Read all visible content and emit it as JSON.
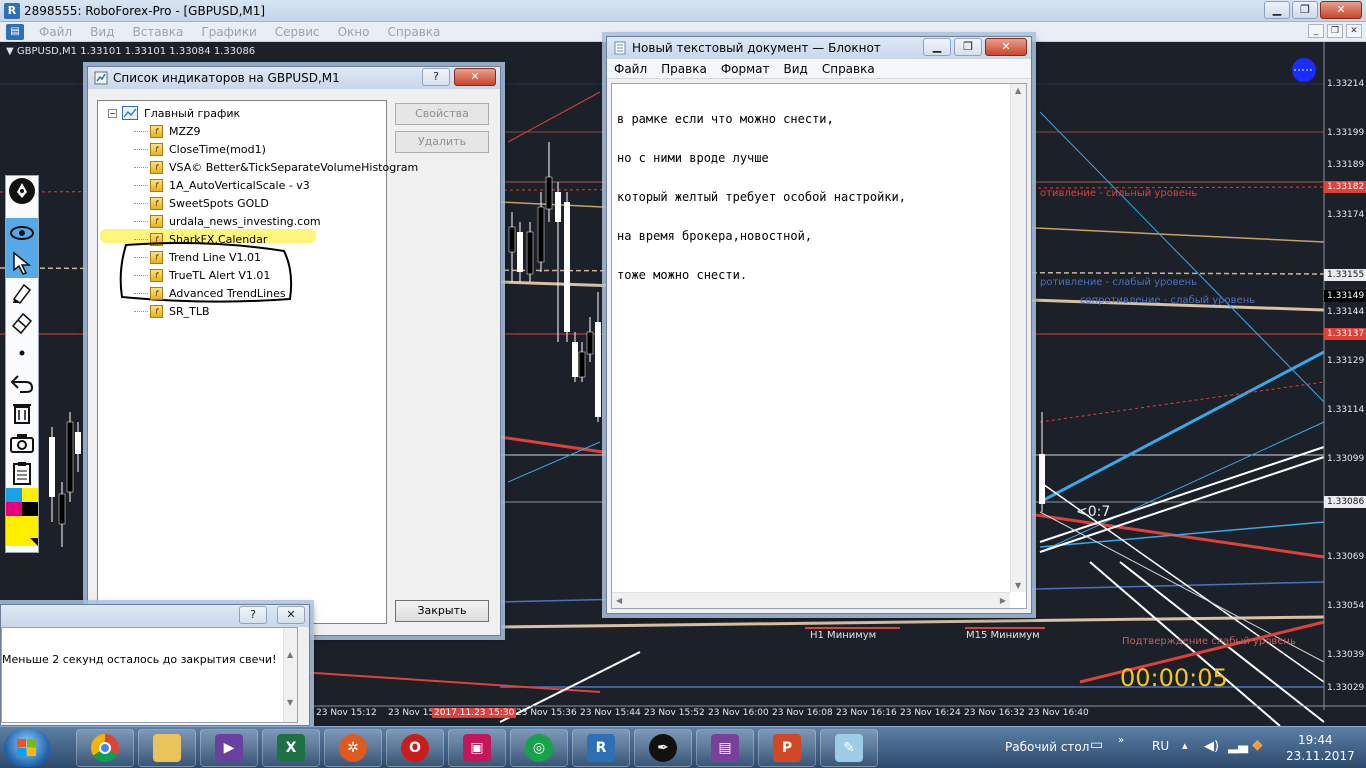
{
  "app": {
    "title": "2898555: RoboForex-Pro - [GBPUSD,M1]",
    "icon_letter": "R",
    "menu": [
      "Файл",
      "Вид",
      "Вставка",
      "Графики",
      "Сервис",
      "Окно",
      "Справка"
    ]
  },
  "chart": {
    "symbol_info": "▼ GBPUSD,M1  1.33101 1.33101 1.33084 1.33086",
    "price_labels": [
      {
        "text": "1.33214",
        "style": "plain"
      },
      {
        "text": "1.33199",
        "style": "plain"
      },
      {
        "text": "1.33189",
        "style": "plain"
      },
      {
        "text": "1.33182",
        "style": "red"
      },
      {
        "text": "1.33174",
        "style": "plain"
      },
      {
        "text": "1.33155",
        "style": "boxed"
      },
      {
        "text": "1.33149",
        "style": "dark"
      },
      {
        "text": "1.33144",
        "style": "plain"
      },
      {
        "text": "1.33137",
        "style": "red"
      },
      {
        "text": "1.33129",
        "style": "plain"
      },
      {
        "text": "1.33114",
        "style": "plain"
      },
      {
        "text": "1.33099",
        "style": "plain"
      },
      {
        "text": "1.33086",
        "style": "boxed"
      },
      {
        "text": "1.33069",
        "style": "plain"
      },
      {
        "text": "1.33054",
        "style": "plain"
      },
      {
        "text": "1.33039",
        "style": "plain"
      },
      {
        "text": "1.33029",
        "style": "plain"
      }
    ],
    "time_labels": [
      {
        "text": "23 Nov 15:12",
        "style": "plain"
      },
      {
        "text": "23 Nov 15:",
        "style": "plain"
      },
      {
        "text": "2017.11.23 15:30",
        "style": "red"
      },
      {
        "text": "23 Nov 15:36",
        "style": "plain"
      },
      {
        "text": "23 Nov 15:44",
        "style": "plain"
      },
      {
        "text": "23 Nov 15:52",
        "style": "plain"
      },
      {
        "text": "23 Nov 16:00",
        "style": "plain"
      },
      {
        "text": "23 Nov 16:08",
        "style": "plain"
      },
      {
        "text": "23 Nov 16:16",
        "style": "plain"
      },
      {
        "text": "23 Nov 16:24",
        "style": "plain"
      },
      {
        "text": "23 Nov 16:32",
        "style": "plain"
      },
      {
        "text": "23 Nov 16:40",
        "style": "plain"
      }
    ],
    "annotations": {
      "strong_level": "отивление - сильный уровень",
      "weak_level_1": "ротивление - слабый уровень",
      "weak_level_2": "сопротивление - слабый уровень",
      "h1_min": "H1 Минимум",
      "m15_min": "M15 Минимум",
      "support": "Подтверждение слабый уровень",
      "ratio": "<0:7",
      "countdown": "00:00:05"
    },
    "colors": {
      "background": "#1c2029",
      "support_line": "#e0403a",
      "trend_line": "#39a8e8",
      "countdown": "#f2c523"
    }
  },
  "draw_toolbar": {
    "tools": [
      "pen-icon",
      "eye-icon",
      "cursor-icon",
      "marker-icon",
      "eraser-icon",
      "dot-icon",
      "undo-icon",
      "trash-icon",
      "camera-icon",
      "clipboard-icon"
    ]
  },
  "indicators_dialog": {
    "title": "Список индикаторов на GBPUSD,M1",
    "help": "?",
    "close": "✕",
    "root": "Главный график",
    "items": [
      "MZZ9",
      "CloseTime(mod1)",
      "VSA© Better&TickSeparateVolumeHistogram",
      "1A_AutoVerticalScale - v3",
      "SweetSpots GOLD",
      "urdala_news_investing.com",
      "SharkFX.Calendar",
      "Trend Line V1.01",
      "TrueTL Alert V1.01",
      "Advanced TrendLines",
      "SR_TLB"
    ],
    "buttons": {
      "properties": "Свойства",
      "delete": "Удалить",
      "close": "Закрыть"
    }
  },
  "notepad": {
    "title": "Новый текстовый документ — Блокнот",
    "menu": [
      "Файл",
      "Правка",
      "Формат",
      "Вид",
      "Справка"
    ],
    "lines": [
      "в рамке если что можно снести,",
      "но с ними вроде лучше",
      "который желтый требует особой настройки,",
      "на время брокера,новостной,",
      "тоже можно снести."
    ]
  },
  "alert_dialog": {
    "help": "?",
    "close": "✕",
    "message": "Меньше 2 секунд осталось до закрытия свечи!"
  },
  "taskbar": {
    "apps": [
      "internet-explorer",
      "chrome",
      "explorer",
      "visual-studio",
      "excel",
      "app-red",
      "opera",
      "app-pink",
      "app-green",
      "roboforex",
      "pen-app",
      "winrar",
      "powerpoint",
      "notepad"
    ],
    "desktop_label": "Рабочий стол",
    "lang": "RU",
    "time": "19:44",
    "date": "23.11.2017"
  }
}
